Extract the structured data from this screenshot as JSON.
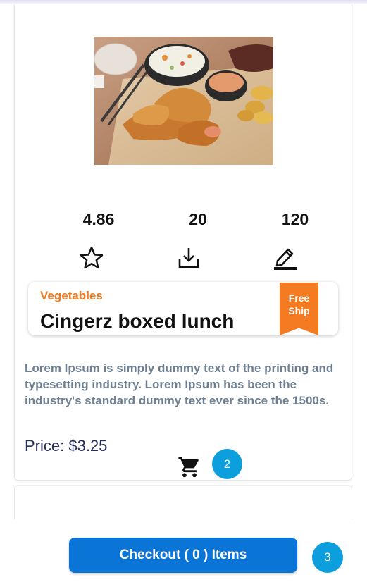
{
  "product": {
    "image_alt": "Fried chicken tenders with coleslaw, dipping sauce and chips",
    "stats": {
      "rating": "4.86",
      "downloads": "20",
      "edits": "120"
    },
    "stat_icons": [
      "star-icon",
      "download-icon",
      "edit-icon"
    ],
    "category": "Vegetables",
    "title": "Cingerz boxed lunch",
    "ribbon": {
      "line1": "Free",
      "line2": "Ship"
    },
    "description": "Lorem Ipsum is simply dummy text of the printing and typesetting industry. Lorem Ipsum has been the industry's standard dummy text ever since the 1500s.",
    "price_label": "Price: ",
    "price_value": "$3.25",
    "cart_badge": "2"
  },
  "footer": {
    "checkout_label": "Checkout ( 0 ) Items",
    "page_badge": "3"
  },
  "colors": {
    "accent_orange": "#f57b23",
    "checkout_blue": "#0b74d7",
    "badge_blue": "#0d9ede",
    "description_gray": "#6e7f92",
    "price_navy": "#26305a"
  }
}
